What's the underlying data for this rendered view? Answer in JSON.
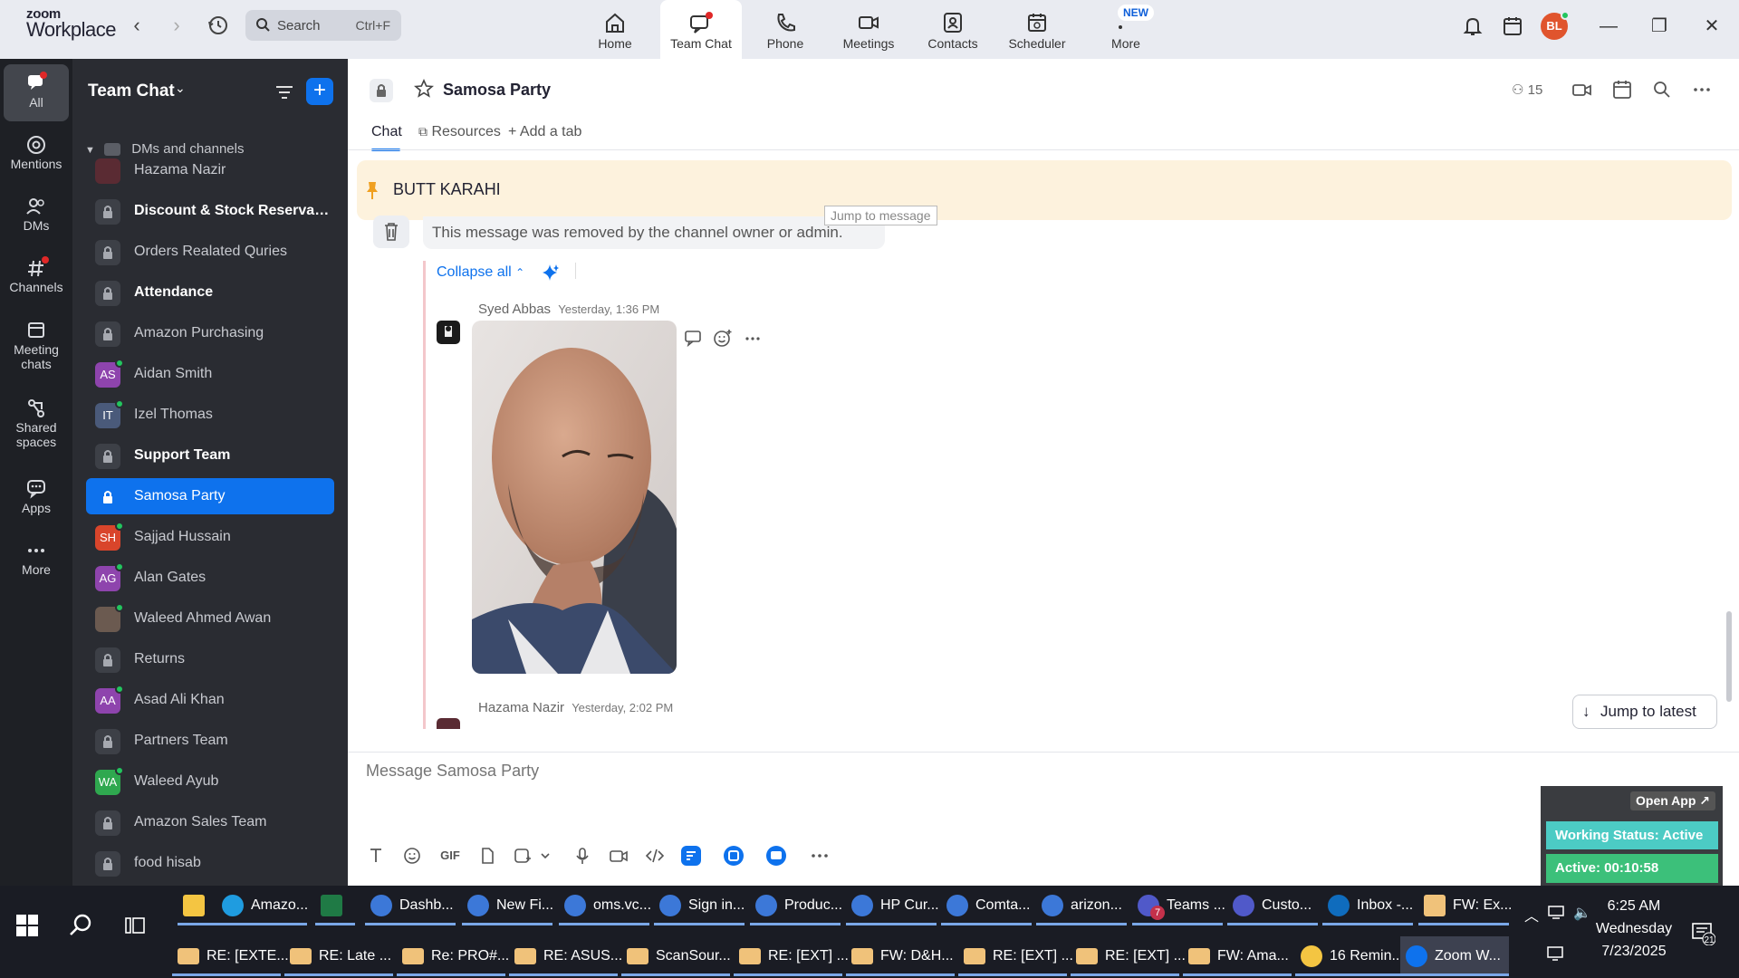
{
  "app": {
    "logo_line1": "zoom",
    "logo_line2": "Workplace"
  },
  "search": {
    "placeholder": "Search",
    "shortcut": "Ctrl+F"
  },
  "topnav": [
    {
      "label": "Home",
      "icon": "home-icon"
    },
    {
      "label": "Team Chat",
      "icon": "chat-icon",
      "active": true
    },
    {
      "label": "Phone",
      "icon": "phone-icon"
    },
    {
      "label": "Meetings",
      "icon": "video-icon"
    },
    {
      "label": "Contacts",
      "icon": "contacts-icon"
    },
    {
      "label": "Scheduler",
      "icon": "calendar-icon"
    },
    {
      "label": "More",
      "icon": "more-icon"
    }
  ],
  "new_badge": "NEW",
  "profile": {
    "initials": "BL",
    "color": "#e0542d"
  },
  "rail": [
    {
      "label": "All",
      "active": true
    },
    {
      "label": "Mentions"
    },
    {
      "label": "DMs"
    },
    {
      "label": "Channels"
    },
    {
      "label": "Meeting chats"
    },
    {
      "label": "Shared spaces"
    },
    {
      "label": "Apps"
    },
    {
      "label": "More"
    }
  ],
  "sidebar": {
    "title": "Team Chat",
    "section": "DMs and channels",
    "items": [
      {
        "name": "Hazama Nazir",
        "type": "photo",
        "color": "#5a2b33"
      },
      {
        "name": "Discount & Stock Reservation",
        "type": "lock",
        "bold": true
      },
      {
        "name": "Orders Realated Quries",
        "type": "lock"
      },
      {
        "name": "Attendance",
        "type": "lock",
        "bold": true
      },
      {
        "name": "Amazon Purchasing",
        "type": "lock"
      },
      {
        "name": "Aidan Smith",
        "type": "initials",
        "initials": "AS",
        "color": "#8e44ad",
        "online": true
      },
      {
        "name": "Izel Thomas",
        "type": "initials",
        "initials": "IT",
        "color": "#4a5a7a",
        "online": true
      },
      {
        "name": "Support Team",
        "type": "lock",
        "bold": true
      },
      {
        "name": "Samosa Party",
        "type": "lock",
        "selected": true
      },
      {
        "name": "Sajjad Hussain",
        "type": "initials",
        "initials": "SH",
        "color": "#d9452b",
        "online": true
      },
      {
        "name": "Alan Gates",
        "type": "initials",
        "initials": "AG",
        "color": "#8e44ad",
        "online": true
      },
      {
        "name": "Waleed Ahmed Awan",
        "type": "photo",
        "color": "#6b5a50",
        "online": true
      },
      {
        "name": "Returns",
        "type": "lock"
      },
      {
        "name": "Asad Ali Khan",
        "type": "initials",
        "initials": "AA",
        "color": "#8e44ad",
        "online": true
      },
      {
        "name": "Partners Team",
        "type": "lock"
      },
      {
        "name": "Waleed Ayub",
        "type": "initials",
        "initials": "WA",
        "color": "#2fa84f",
        "online": true
      },
      {
        "name": "Amazon Sales Team",
        "type": "lock"
      },
      {
        "name": "food hisab",
        "type": "lock"
      }
    ]
  },
  "channel": {
    "title": "Samosa Party",
    "members": "15",
    "tabs": [
      "Chat",
      "Resources",
      "Add a tab"
    ]
  },
  "pinned": {
    "text": "BUTT KARAHI",
    "tooltip": "Jump to message"
  },
  "removed_message": "This message was removed by the channel owner or admin.",
  "thread": {
    "collapse_label": "Collapse all",
    "messages": [
      {
        "sender": "Syed Abbas",
        "time": "Yesterday, 1:36 PM"
      },
      {
        "sender": "Hazama Nazir",
        "time": "Yesterday, 2:02 PM"
      }
    ]
  },
  "jump_latest": "Jump to latest",
  "composer": {
    "placeholder": "Message Samosa Party"
  },
  "composer_toolbar": {
    "gif_label": "GIF"
  },
  "widget": {
    "open_app": "Open App ↗",
    "status": "Working Status: Active",
    "active": "Active: 00:10:58"
  },
  "taskbar": {
    "row1": [
      {
        "label": "",
        "icon": "folder-icon",
        "color": "#f4c542"
      },
      {
        "label": "Amazo...",
        "icon": "edge-icon",
        "color": "#1f9ce0"
      },
      {
        "label": "",
        "icon": "excel-icon",
        "color": "#1f7a45"
      },
      {
        "label": "Dashb...",
        "icon": "chrome-icon",
        "color": "#3c78d8"
      },
      {
        "label": "New Fi...",
        "icon": "chrome-icon",
        "color": "#3c78d8"
      },
      {
        "label": "oms.vc...",
        "icon": "chrome-icon",
        "color": "#3c78d8"
      },
      {
        "label": "Sign in...",
        "icon": "chrome-icon",
        "color": "#3c78d8"
      },
      {
        "label": "Produc...",
        "icon": "chrome-icon",
        "color": "#3c78d8"
      },
      {
        "label": "HP Cur...",
        "icon": "chrome-icon",
        "color": "#3c78d8"
      },
      {
        "label": "Comta...",
        "icon": "chrome-icon",
        "color": "#3c78d8"
      },
      {
        "label": "arizon...",
        "icon": "chrome-icon",
        "color": "#3c78d8"
      },
      {
        "label": "Teams ...",
        "icon": "teams-icon",
        "color": "#5059c9"
      },
      {
        "label": "Custo...",
        "icon": "teams-icon",
        "color": "#5059c9"
      },
      {
        "label": "Inbox -...",
        "icon": "outlook-icon",
        "color": "#0f6cbd"
      },
      {
        "label": "FW: Ex...",
        "icon": "mail-icon",
        "color": "#f0c27a"
      }
    ],
    "row2": [
      {
        "label": "RE: [EXTE...",
        "icon": "mail-icon"
      },
      {
        "label": "RE: Late ...",
        "icon": "mail-icon"
      },
      {
        "label": "Re: PRO#...",
        "icon": "mail-icon"
      },
      {
        "label": "RE: ASUS...",
        "icon": "mail-icon"
      },
      {
        "label": "ScanSour...",
        "icon": "mail-icon"
      },
      {
        "label": "RE: [EXT] ...",
        "icon": "mail-icon"
      },
      {
        "label": "FW: D&H...",
        "icon": "mail-icon"
      },
      {
        "label": "RE: [EXT] ...",
        "icon": "mail-icon"
      },
      {
        "label": "RE: [EXT] ...",
        "icon": "mail-icon"
      },
      {
        "label": "FW: Ama...",
        "icon": "mail-icon"
      },
      {
        "label": "16 Remin...",
        "icon": "bell-icon"
      },
      {
        "label": "Zoom W...",
        "icon": "zoom-icon"
      }
    ],
    "teams_badge": "7",
    "time": "6:25 AM",
    "day": "Wednesday",
    "date": "7/23/2025",
    "notif_count": "21"
  }
}
